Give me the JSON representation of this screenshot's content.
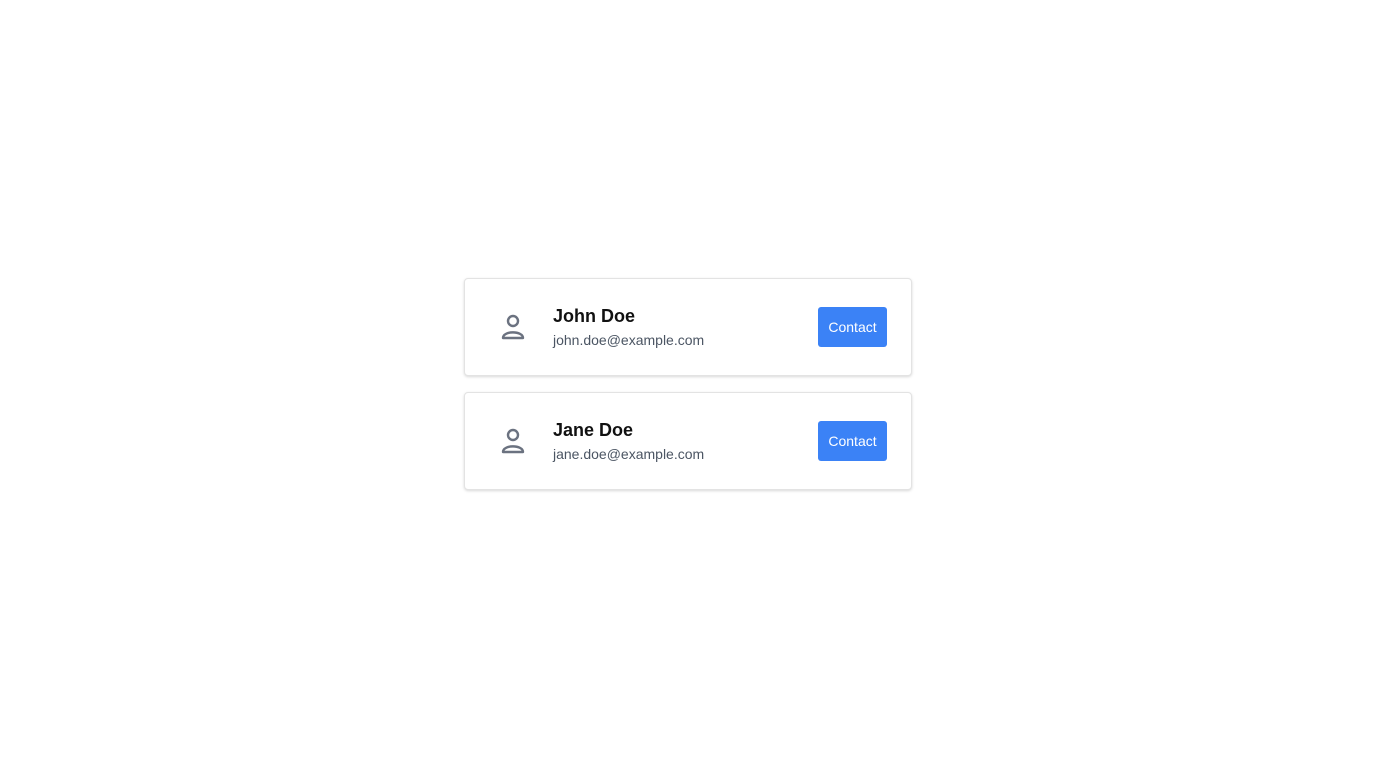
{
  "contacts": [
    {
      "name": "John Doe",
      "email": "john.doe@example.com",
      "avatar_icon": "user-icon",
      "button_label": "Contact"
    },
    {
      "name": "Jane Doe",
      "email": "jane.doe@example.com",
      "avatar_icon": "user-icon",
      "button_label": "Contact"
    }
  ],
  "colors": {
    "accent": "#3b82f6",
    "name_text": "#111111",
    "email_text": "#4b5563",
    "icon": "#6b7280",
    "card_border": "#e3e3e3"
  }
}
